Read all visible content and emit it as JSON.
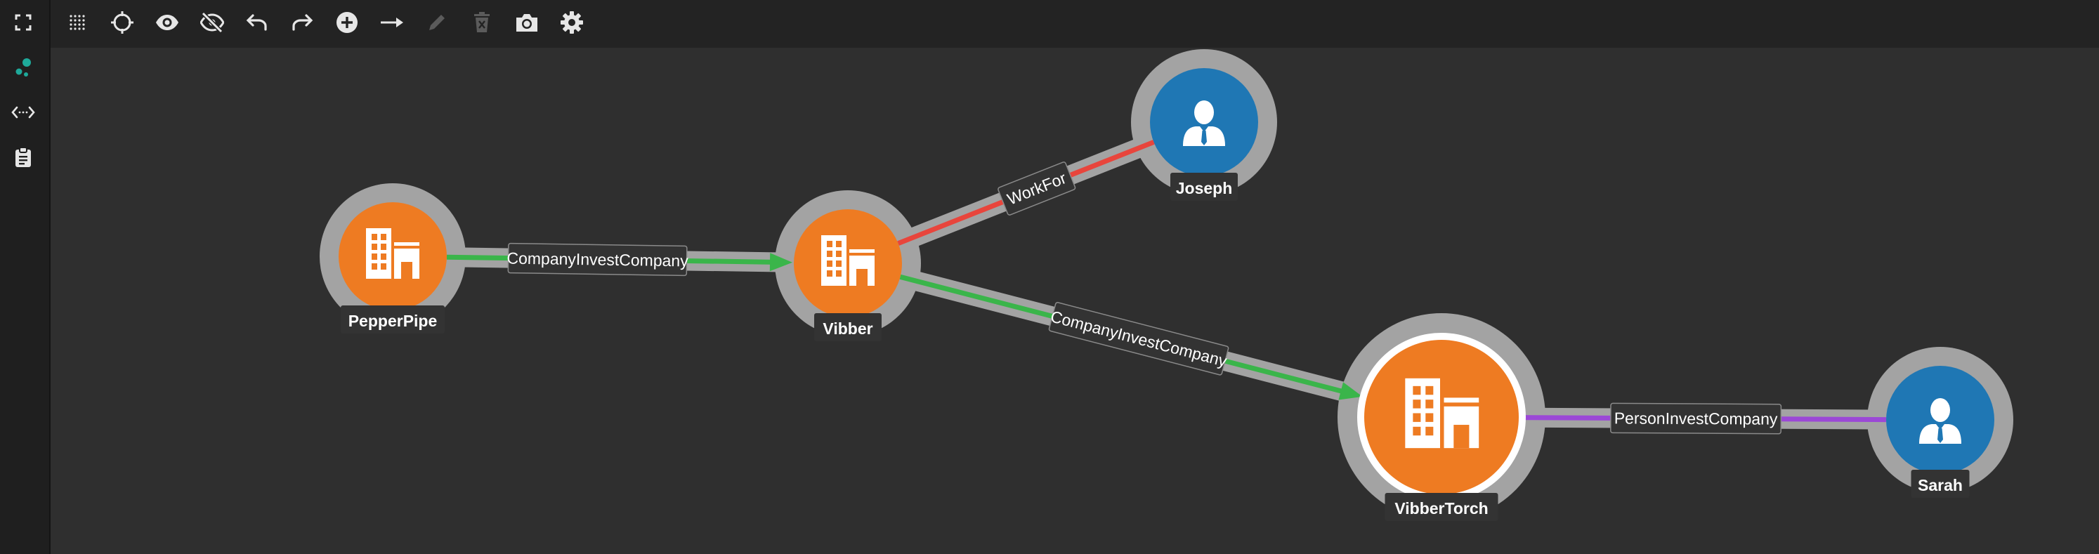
{
  "sidebar": {
    "items": [
      {
        "name": "fullscreen-icon",
        "icon": "fullscreen"
      },
      {
        "name": "graph-icon",
        "icon": "graph-nodes",
        "active_color": "#1ea99a"
      },
      {
        "name": "code-icon",
        "icon": "code-arrows"
      },
      {
        "name": "clipboard-icon",
        "icon": "clipboard"
      }
    ]
  },
  "toolbar": {
    "tools": [
      {
        "name": "grid-icon",
        "icon": "dot-grid",
        "enabled": true
      },
      {
        "name": "crosshair-icon",
        "icon": "crosshair",
        "enabled": true
      },
      {
        "name": "eye-icon",
        "icon": "eye",
        "enabled": true
      },
      {
        "name": "eye-off-icon",
        "icon": "eye-off",
        "enabled": true
      },
      {
        "name": "undo-icon",
        "icon": "undo",
        "enabled": true
      },
      {
        "name": "redo-icon",
        "icon": "redo",
        "enabled": true
      },
      {
        "name": "add-node-icon",
        "icon": "plus-circle",
        "enabled": true
      },
      {
        "name": "add-edge-icon",
        "icon": "arrow-right",
        "enabled": true
      },
      {
        "name": "edit-icon",
        "icon": "pencil",
        "enabled": false
      },
      {
        "name": "delete-icon",
        "icon": "trash",
        "enabled": false
      },
      {
        "name": "camera-icon",
        "icon": "camera",
        "enabled": true
      },
      {
        "name": "settings-icon",
        "icon": "gear",
        "enabled": true
      }
    ]
  },
  "graph": {
    "colors": {
      "company": "#ee7b22",
      "person": "#1f77b4",
      "halo": "#a3a3a3",
      "company_invest": "#3ab54a",
      "work_for": "#e8453c",
      "person_invest": "#9b48d6",
      "label_bg": "#333333",
      "selected_ring": "#ffffff"
    },
    "nodes": [
      {
        "id": "pepperpipe",
        "label": "PepperPipe",
        "type": "company",
        "selected": false
      },
      {
        "id": "vibber",
        "label": "Vibber",
        "type": "company",
        "selected": false
      },
      {
        "id": "joseph",
        "label": "Joseph",
        "type": "person",
        "selected": false
      },
      {
        "id": "vibbertorch",
        "label": "VibberTorch",
        "type": "company",
        "selected": true
      },
      {
        "id": "sarah",
        "label": "Sarah",
        "type": "person",
        "selected": false
      }
    ],
    "edges": [
      {
        "from": "pepperpipe",
        "to": "vibber",
        "label": "CompanyInvestCompany",
        "kind": "company_invest",
        "arrow": true
      },
      {
        "from": "vibber",
        "to": "joseph",
        "label": "WorkFor",
        "kind": "work_for",
        "arrow": false
      },
      {
        "from": "vibber",
        "to": "vibbertorch",
        "label": "CompanyInvestCompany",
        "kind": "company_invest",
        "arrow": true
      },
      {
        "from": "vibbertorch",
        "to": "sarah",
        "label": "PersonInvestCompany",
        "kind": "person_invest",
        "arrow": false
      }
    ]
  }
}
